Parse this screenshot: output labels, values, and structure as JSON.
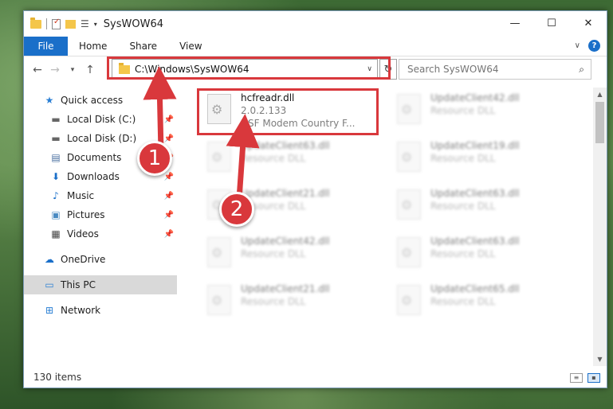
{
  "window": {
    "title": "SysWOW64",
    "controls": {
      "minimize": "—",
      "maximize": "☐",
      "close": "✕"
    }
  },
  "ribbon": {
    "tabs": [
      "File",
      "Home",
      "Share",
      "View"
    ],
    "help_glyph": "?"
  },
  "nav": {
    "address": "C:\\Windows\\SysWOW64",
    "search_placeholder": "Search SysWOW64"
  },
  "sidebar": {
    "items": [
      {
        "label": "Quick access",
        "icon": "star-icon",
        "glyph": "★"
      },
      {
        "label": "Local Disk (C:)",
        "icon": "drive-icon",
        "glyph": "▬"
      },
      {
        "label": "Local Disk (D:)",
        "icon": "drive-icon",
        "glyph": "▬"
      },
      {
        "label": "Documents",
        "icon": "documents-icon",
        "glyph": "▤"
      },
      {
        "label": "Downloads",
        "icon": "downloads-icon",
        "glyph": "⬇"
      },
      {
        "label": "Music",
        "icon": "music-icon",
        "glyph": "♪"
      },
      {
        "label": "Pictures",
        "icon": "pictures-icon",
        "glyph": "▣"
      },
      {
        "label": "Videos",
        "icon": "videos-icon",
        "glyph": "▦"
      },
      {
        "label": "OneDrive",
        "icon": "cloud-icon",
        "glyph": "☁"
      },
      {
        "label": "This PC",
        "icon": "computer-icon",
        "glyph": "▭"
      },
      {
        "label": "Network",
        "icon": "network-icon",
        "glyph": "⊞"
      }
    ]
  },
  "files": [
    {
      "name": "hcfreadr.dll",
      "line2": "2.0.2.133",
      "line3": "HSF Modem Country F..."
    },
    {
      "name": "UpdateClient42.dll",
      "line2": "Resource DLL"
    },
    {
      "name": "UpdateClient63.dll",
      "line2": "Resource DLL"
    },
    {
      "name": "UpdateClient19.dll",
      "line2": "Resource DLL"
    },
    {
      "name": "UpdateClient21.dll",
      "line2": "Resource DLL"
    },
    {
      "name": "UpdateClient63.dll",
      "line2": "Resource DLL"
    },
    {
      "name": "UpdateClient42.dll",
      "line2": "Resource DLL"
    },
    {
      "name": "UpdateClient63.dll",
      "line2": "Resource DLL"
    },
    {
      "name": "UpdateClient21.dll",
      "line2": "Resource DLL"
    },
    {
      "name": "UpdateClient65.dll",
      "line2": "Resource DLL"
    }
  ],
  "status": {
    "item_count": "130 items"
  },
  "markers": [
    "1",
    "2"
  ],
  "colors": {
    "accent": "#1a6fc9",
    "highlight": "#d9383c"
  }
}
